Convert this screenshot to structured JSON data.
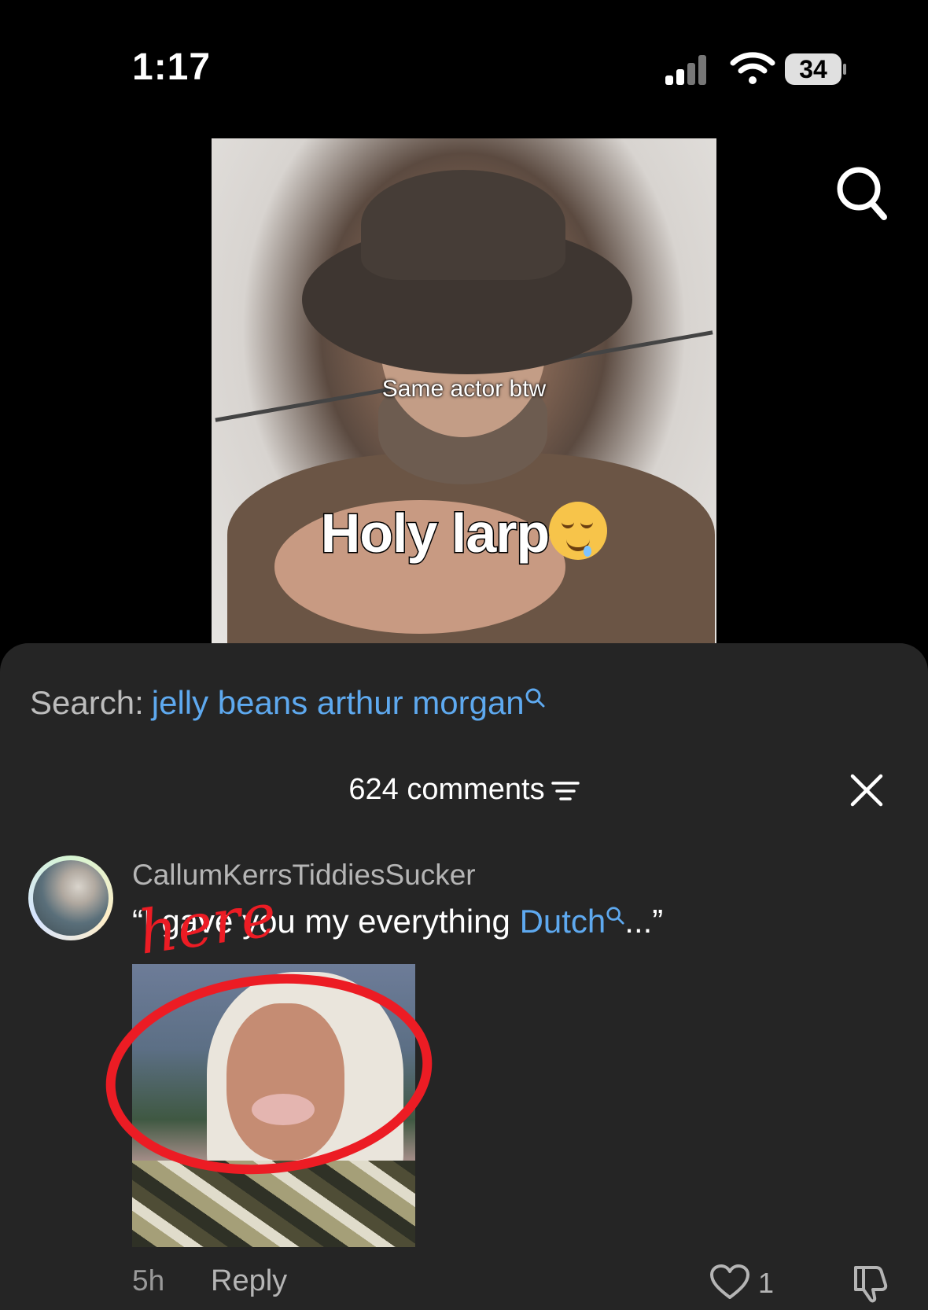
{
  "status_bar": {
    "time": "1:17",
    "battery": "34"
  },
  "video": {
    "caption_small": "Same actor btw",
    "caption_big": "Holy larp"
  },
  "search": {
    "label": "Search:",
    "query": "jelly beans arthur morgan"
  },
  "comments": {
    "count_label": "624 comments",
    "items": [
      {
        "username": "CallumKerrsTiddiesSucker",
        "text_prefix": "“I gave you my everything ",
        "text_link": "Dutch",
        "text_suffix": "...”",
        "annotation": "here",
        "age": "5h",
        "reply_label": "Reply",
        "likes": "1"
      }
    ]
  },
  "icons": [
    "search-icon",
    "filter-icon",
    "close-icon",
    "heart-icon",
    "dislike-icon",
    "signal-icon",
    "wifi-icon",
    "battery-icon"
  ],
  "colors": {
    "link": "#5ea9ef",
    "sheet_bg": "#252525",
    "annotation_red": "#ec1c24"
  }
}
